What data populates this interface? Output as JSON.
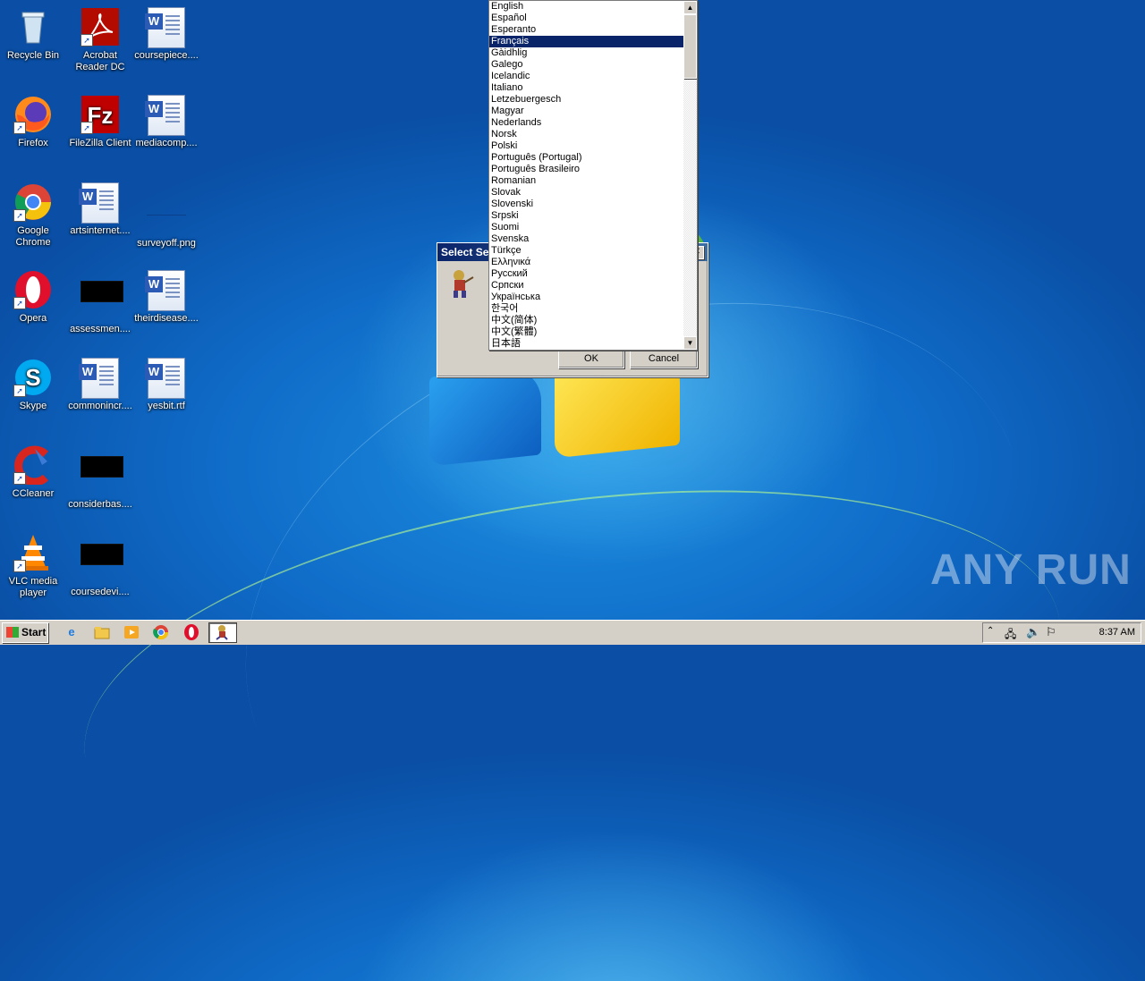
{
  "desktop": {
    "icons": [
      {
        "label": "Recycle Bin"
      },
      {
        "label": "Acrobat Reader DC"
      },
      {
        "label": "coursepiece...."
      },
      {
        "label": "Firefox"
      },
      {
        "label": "FileZilla Client"
      },
      {
        "label": "mediacomp...."
      },
      {
        "label": "Google Chrome"
      },
      {
        "label": "artsinternet...."
      },
      {
        "label": "surveyoff.png"
      },
      {
        "label": "Opera"
      },
      {
        "label": "assessmen...."
      },
      {
        "label": "theirdisease...."
      },
      {
        "label": "Skype"
      },
      {
        "label": "commonincr...."
      },
      {
        "label": "yesbit.rtf"
      },
      {
        "label": "CCleaner"
      },
      {
        "label": "considerbas...."
      },
      {
        "label": "VLC media player"
      },
      {
        "label": "coursedevi...."
      }
    ]
  },
  "dialog": {
    "title": "Select Setup Language",
    "ok_label": "OK",
    "cancel_label": "Cancel",
    "close_glyph": "✕"
  },
  "language_list": {
    "selected": "Français",
    "items": [
      "English",
      "Español",
      "Esperanto",
      "Français",
      "Gàidhlig",
      "Galego",
      "Icelandic",
      "Italiano",
      "Letzebuergesch",
      "Magyar",
      "Nederlands",
      "Norsk",
      "Polski",
      "Português (Portugal)",
      "Português Brasileiro",
      "Romanian",
      "Slovak",
      "Slovenski",
      "Srpski",
      "Suomi",
      "Svenska",
      "Türkçe",
      "Ελληνικά",
      "Русский",
      "Српски",
      "Українська",
      "한국어",
      "中文(简体)",
      "中文(繁體)",
      "日本語"
    ]
  },
  "taskbar": {
    "start_label": "Start",
    "clock": "8:37 AM"
  },
  "watermark": "ANY RUN",
  "colors": {
    "selection": "#0a246a",
    "dialog_face": "#d4d0c8",
    "desktop_blue": "#0f6bc7"
  }
}
